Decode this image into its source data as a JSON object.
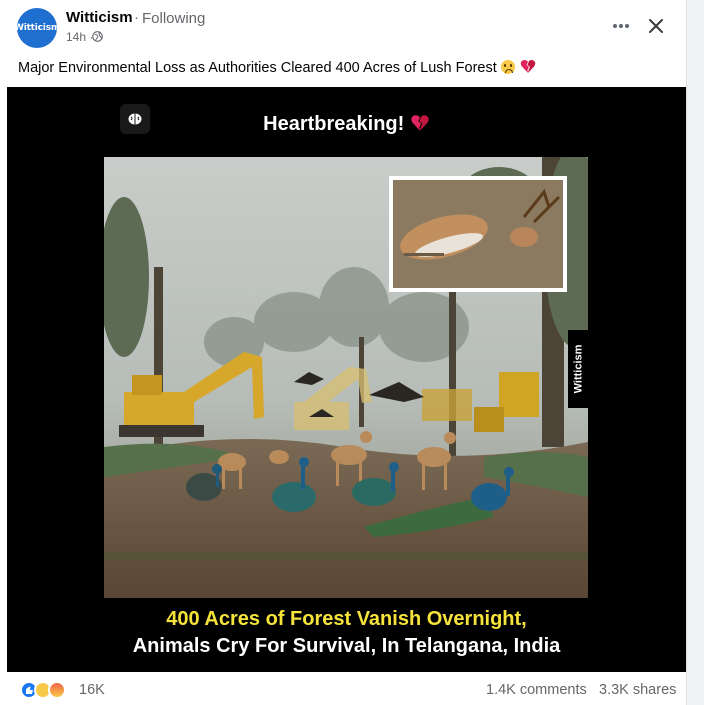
{
  "post": {
    "author": "Witticism",
    "avatar_text": "Witticism",
    "separator": "·",
    "follow_status": "Following",
    "time": "14h",
    "time_separator": "·",
    "caption": "Major Environmental Loss as Authorities Cleared 400 Acres of Lush Forest",
    "caption_emojis": [
      "sad-face-emoji",
      "broken-heart-emoji"
    ]
  },
  "media": {
    "headline": "Heartbreaking!",
    "side_tag": "Witticism",
    "bottom_line1": "400 Acres of Forest Vanish Overnight,",
    "bottom_line2": "Animals Cry For Survival, In Telangana, India"
  },
  "footer": {
    "reaction_count": "16K",
    "comments": "1.4K comments",
    "shares": "3.3K shares"
  },
  "colors": {
    "brand": "#1877f2",
    "avatar_bg": "#1f6fd0",
    "headline_yellow": "#f5e23a",
    "muted_text": "#65676b"
  },
  "icons": [
    "more-options-icon",
    "close-icon",
    "globe-icon",
    "brain-logo-icon",
    "like-reaction-icon",
    "sad-reaction-icon",
    "angry-reaction-icon"
  ]
}
